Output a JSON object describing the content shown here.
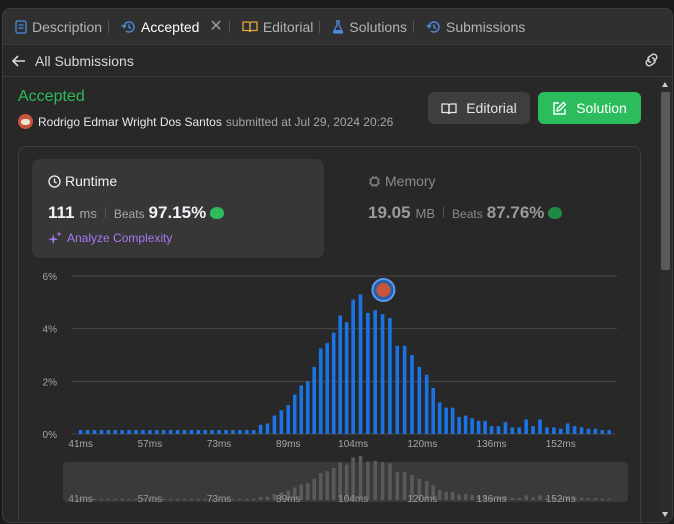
{
  "tabs": [
    {
      "label": "Description",
      "icon": "description-icon"
    },
    {
      "label": "Accepted",
      "icon": "history-icon",
      "active": true
    },
    {
      "label": "Editorial",
      "icon": "book-icon"
    },
    {
      "label": "Solutions",
      "icon": "flask-icon"
    },
    {
      "label": "Submissions",
      "icon": "history-icon"
    }
  ],
  "close_symbol": "✕",
  "subheader": {
    "back_label": "All Submissions"
  },
  "submission": {
    "status": "Accepted",
    "user": "Rodrigo Edmar Wright Dos Santos",
    "submitted_text": "submitted at Jul 29, 2024 20:26"
  },
  "buttons": {
    "editorial": "Editorial",
    "solution": "Solution"
  },
  "runtime": {
    "title": "Runtime",
    "value": "111",
    "unit": "ms",
    "beats_label": "Beats",
    "beats_pct": "97.15%",
    "analyze": "Analyze Complexity"
  },
  "memory": {
    "title": "Memory",
    "value": "19.05",
    "unit": "MB",
    "beats_label": "Beats",
    "beats_pct": "87.76%"
  },
  "colors": {
    "accent_green": "#2cbb5d",
    "bar_blue": "#1a74e5",
    "purple": "#a977f6"
  },
  "chart_data": {
    "type": "bar",
    "y_ticks": [
      "6%",
      "4%",
      "2%",
      "0%"
    ],
    "ylim": [
      0,
      6
    ],
    "x_ticks": [
      "41ms",
      "57ms",
      "73ms",
      "89ms",
      "104ms",
      "120ms",
      "136ms",
      "152ms"
    ],
    "xlim": [
      39,
      165
    ],
    "x": [
      41,
      42.6,
      44.2,
      45.8,
      47.4,
      49,
      50.6,
      52.2,
      53.8,
      55.4,
      57,
      58.6,
      60.2,
      61.8,
      63.4,
      65,
      66.6,
      68.2,
      69.8,
      71.4,
      73,
      74.6,
      76.2,
      77.8,
      79.4,
      81,
      82.6,
      84.2,
      85.8,
      87.4,
      89,
      90.5,
      92,
      93.5,
      95,
      96.5,
      98,
      99.5,
      101,
      102.5,
      104,
      105.7,
      107.4,
      109.1,
      110.8,
      112.5,
      114.2,
      115.9,
      117.6,
      119.3,
      121,
      122.5,
      124,
      125.5,
      127,
      128.5,
      130,
      131.5,
      133,
      134.5,
      136,
      137.6,
      139.2,
      140.8,
      142.4,
      144,
      145.6,
      147.2,
      148.8,
      150.4,
      152,
      153.6,
      155.2,
      156.8,
      158.4,
      160,
      161.6,
      163.2
    ],
    "values": [
      0.15,
      0.15,
      0.15,
      0.15,
      0.15,
      0.15,
      0.15,
      0.15,
      0.15,
      0.15,
      0.15,
      0.15,
      0.15,
      0.15,
      0.15,
      0.15,
      0.15,
      0.15,
      0.15,
      0.15,
      0.15,
      0.15,
      0.15,
      0.15,
      0.15,
      0.15,
      0.35,
      0.4,
      0.7,
      0.9,
      1.1,
      1.5,
      1.85,
      2.0,
      2.55,
      3.25,
      3.45,
      3.85,
      4.5,
      4.25,
      5.1,
      5.3,
      4.6,
      4.7,
      4.55,
      4.4,
      3.35,
      3.35,
      3.0,
      2.55,
      2.25,
      1.75,
      1.2,
      1.0,
      1.0,
      0.65,
      0.7,
      0.6,
      0.5,
      0.5,
      0.3,
      0.3,
      0.45,
      0.25,
      0.25,
      0.55,
      0.3,
      0.55,
      0.25,
      0.25,
      0.2,
      0.4,
      0.3,
      0.25,
      0.2,
      0.2,
      0.15,
      0.15
    ],
    "highlight_x": 111
  }
}
